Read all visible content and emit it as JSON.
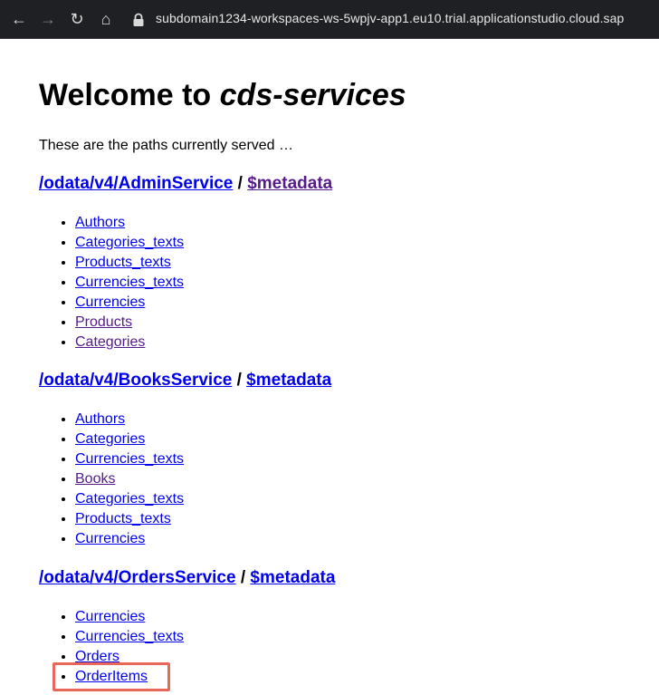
{
  "browser": {
    "url": "subdomain1234-workspaces-ws-5wpjv-app1.eu10.trial.applicationstudio.cloud.sap"
  },
  "page": {
    "title_prefix": "Welcome to ",
    "title_em": "cds-services",
    "intro": "These are the paths currently served …"
  },
  "services": [
    {
      "path": "/odata/v4/AdminService",
      "metadata": "$metadata",
      "entities": [
        "Authors",
        "Categories_texts",
        "Products_texts",
        "Currencies_texts",
        "Currencies",
        "Products",
        "Categories"
      ]
    },
    {
      "path": "/odata/v4/BooksService",
      "metadata": "$metadata",
      "entities": [
        "Authors",
        "Categories",
        "Currencies_texts",
        "Books",
        "Categories_texts",
        "Products_texts",
        "Currencies"
      ]
    },
    {
      "path": "/odata/v4/OrdersService",
      "metadata": "$metadata",
      "entities": [
        "Currencies",
        "Currencies_texts",
        "Orders",
        "OrderItems"
      ]
    }
  ],
  "colors": {
    "link": "#0000ee",
    "visited": "#551a8b",
    "highlight": "#e8675a"
  }
}
